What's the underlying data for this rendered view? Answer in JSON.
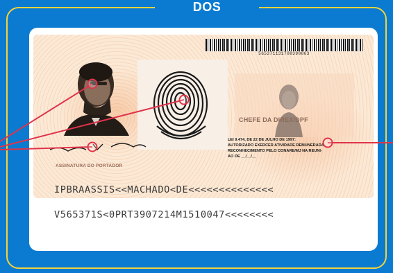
{
  "frame": {
    "title": "DOS"
  },
  "document": {
    "barcode_number": "565371131708390863",
    "chief_label": "CHEFE DA DIREX/DPF",
    "law_text": [
      "LEI 9.474, DE 22 DE JULHO DE 1997:",
      "AUTORIZADO EXERCER ATIVIDADE REMUNERADA.",
      "RECONHECIMENTO PELO CONARE/MJ NA REUNI-",
      "AO DE __/__/__"
    ],
    "signature_label": "ASSINATURA DO PORTADOR",
    "mrz_line1": "IPBRAASSIS<<MACHADO<DE<<<<<<<<<<<<<<",
    "mrz_line2": "V565371S<0PRT3907214M1510047<<<<<<<<"
  },
  "colors": {
    "background": "#0a7bd0",
    "frame_border": "#f5d33a",
    "callout_line": "#e0334a"
  }
}
